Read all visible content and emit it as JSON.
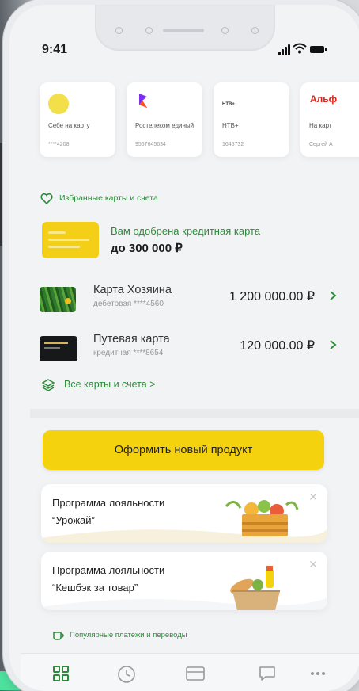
{
  "status_bar": {
    "time": "9:41"
  },
  "quick_transfers": [
    {
      "name": "Себе на карту",
      "number": "****4208",
      "logo": "yellow-coin-icon"
    },
    {
      "name": "Ростелеком единый",
      "number": "9567645634",
      "logo": "rostelecom-logo"
    },
    {
      "name": "НТВ+",
      "number": "1645732",
      "logo": "ntv-plus-logo",
      "logo_text": "НТВ+"
    },
    {
      "name": "На карт",
      "number": "Сергей А",
      "logo": "alfa-logo",
      "logo_text": "Альф"
    }
  ],
  "favorites": {
    "label": "Избранные карты и счета",
    "icon": "heart-icon"
  },
  "credit_offer": {
    "line1": "Вам одобрена кредитная карта",
    "line2": "до 300 000 ₽"
  },
  "accounts": [
    {
      "title": "Карта Хозяина",
      "subtitle": "дебетовая ****4560",
      "amount": "1 200 000.00 ₽",
      "thumb": "green-card-thumb"
    },
    {
      "title": "Путевая карта",
      "subtitle": "кредитная ****8654",
      "amount": "120 000.00 ₽",
      "thumb": "black-card-thumb"
    }
  ],
  "all_accounts": {
    "label": "Все карты и счета",
    "chevron": ">"
  },
  "new_product_button": "Оформить новый продукт",
  "promos": [
    {
      "title": "Программа лояльности",
      "subtitle": "“Урожай”",
      "icon": "harvest-crate-icon"
    },
    {
      "title": "Программа лояльности",
      "subtitle": "“Кешбэк за товар”",
      "icon": "grocery-bag-icon"
    }
  ],
  "popular": {
    "label": "Популярные платежи и переводы",
    "icon": "cup-icon"
  },
  "tabs": [
    {
      "name": "home",
      "icon": "grid-icon",
      "active": true
    },
    {
      "name": "history",
      "icon": "clock-icon"
    },
    {
      "name": "payments",
      "icon": "card-icon"
    },
    {
      "name": "chat",
      "icon": "chat-icon"
    },
    {
      "name": "more",
      "icon": "more-dots-icon"
    }
  ],
  "colors": {
    "accent_green": "#2e8b3a",
    "accent_yellow": "#f5d20e",
    "screen_bg": "#f2f3f5"
  }
}
